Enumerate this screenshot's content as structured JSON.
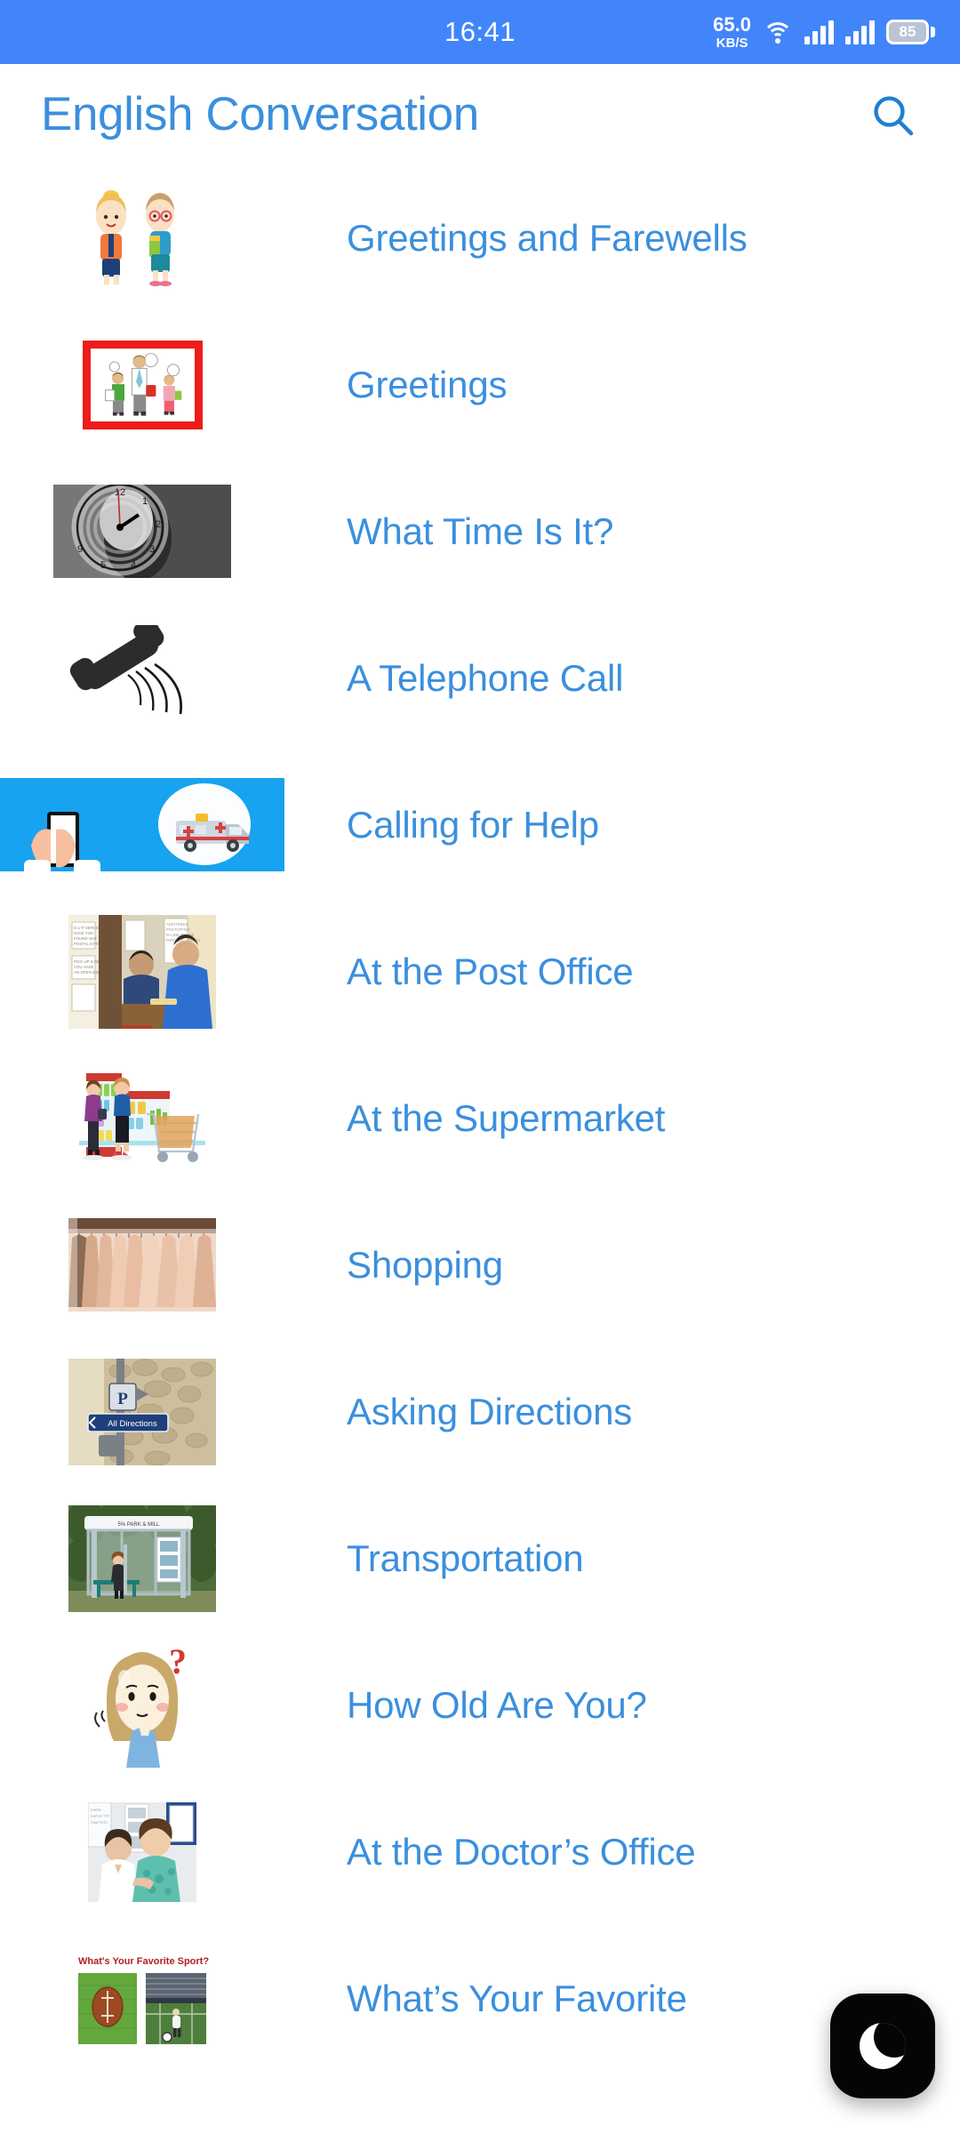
{
  "status_bar": {
    "time": "16:41",
    "net_speed_value": "65.0",
    "net_speed_unit": "KB/S",
    "wifi_icon": "wifi-icon",
    "signal_icon_1": "signal-bars-icon",
    "signal_icon_2": "signal-bars-icon",
    "battery_level": "85",
    "background_color": "#4285fb"
  },
  "app_bar": {
    "title": "English Conversation",
    "search_icon": "search-icon",
    "title_color": "#3b8fdd"
  },
  "list": {
    "items": [
      {
        "label": "Greetings and Farewells",
        "thumb": "two-cartoon-children-icon"
      },
      {
        "label": "Greetings",
        "thumb": "family-greeting-red-framed-icon"
      },
      {
        "label": "What Time Is It?",
        "thumb": "clock-face-grayscale-icon"
      },
      {
        "label": "A Telephone Call",
        "thumb": "telephone-handset-icon"
      },
      {
        "label": "Calling for Help",
        "thumb": "ambulance-phone-icon"
      },
      {
        "label": "At the Post Office",
        "thumb": "post-office-counter-icon"
      },
      {
        "label": "At the Supermarket",
        "thumb": "supermarket-shoppers-icon"
      },
      {
        "label": "Shopping",
        "thumb": "clothes-rack-icon"
      },
      {
        "label": "Asking Directions",
        "thumb": "all-directions-sign-icon"
      },
      {
        "label": "Transportation",
        "thumb": "bus-stop-shelter-icon"
      },
      {
        "label": "How Old Are You?",
        "thumb": "thinking-girl-question-icon"
      },
      {
        "label": "At the Doctor’s Office",
        "thumb": "doctor-patient-icon"
      },
      {
        "label": "What’s Your Favorite",
        "thumb": "favorite-sport-collage-icon"
      }
    ],
    "thumb_texts": {
      "directions_sign": "All Directions",
      "bus_stop_sign": "5% PARK & MILL",
      "sport_caption": "What's Your Favorite Sport?"
    }
  },
  "fab": {
    "icon": "crescent-moon-icon",
    "background_color": "#050505"
  }
}
